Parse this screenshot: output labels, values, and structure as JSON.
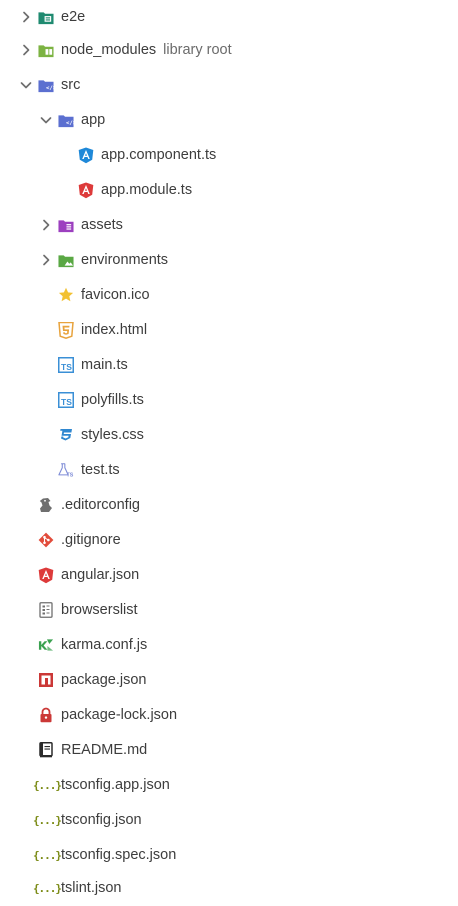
{
  "tree": {
    "items": [
      {
        "name": "e2e",
        "icon": "test-folder-icon",
        "expanded": false
      },
      {
        "name": "node_modules",
        "sublabel": "library root",
        "icon": "library-folder-icon",
        "expanded": false
      },
      {
        "name": "src",
        "icon": "source-folder-icon",
        "expanded": true
      },
      {
        "name": "app",
        "icon": "source-folder-icon",
        "expanded": true
      },
      {
        "name": "app.component.ts",
        "icon": "angular-component-icon"
      },
      {
        "name": "app.module.ts",
        "icon": "angular-icon"
      },
      {
        "name": "assets",
        "icon": "resource-folder-icon",
        "expanded": false
      },
      {
        "name": "environments",
        "icon": "image-folder-icon",
        "expanded": false
      },
      {
        "name": "favicon.ico",
        "icon": "star-icon"
      },
      {
        "name": "index.html",
        "icon": "html5-icon"
      },
      {
        "name": "main.ts",
        "icon": "typescript-icon"
      },
      {
        "name": "polyfills.ts",
        "icon": "typescript-icon"
      },
      {
        "name": "styles.css",
        "icon": "css3-icon"
      },
      {
        "name": "test.ts",
        "icon": "test-flask-icon"
      },
      {
        "name": ".editorconfig",
        "icon": "editorconfig-icon"
      },
      {
        "name": ".gitignore",
        "icon": "git-icon"
      },
      {
        "name": "angular.json",
        "icon": "angular-icon"
      },
      {
        "name": "browserslist",
        "icon": "browserslist-icon"
      },
      {
        "name": "karma.conf.js",
        "icon": "karma-icon"
      },
      {
        "name": "package.json",
        "icon": "npm-icon"
      },
      {
        "name": "package-lock.json",
        "icon": "lock-icon"
      },
      {
        "name": "README.md",
        "icon": "readme-book-icon"
      },
      {
        "name": "tsconfig.app.json",
        "icon": "json-icon"
      },
      {
        "name": "tsconfig.json",
        "icon": "json-icon"
      },
      {
        "name": "tsconfig.spec.json",
        "icon": "json-icon"
      },
      {
        "name": "tslint.json",
        "icon": "json-icon"
      }
    ]
  },
  "colors": {
    "text": "#3d3d3d",
    "sublabel": "#6b6b6b",
    "chevron": "#6e6e6e",
    "angular_red": "#dd3a3a",
    "angular_blue": "#1e88d8",
    "typescript_blue": "#3a8fd6",
    "json_green": "#7a8a14"
  }
}
